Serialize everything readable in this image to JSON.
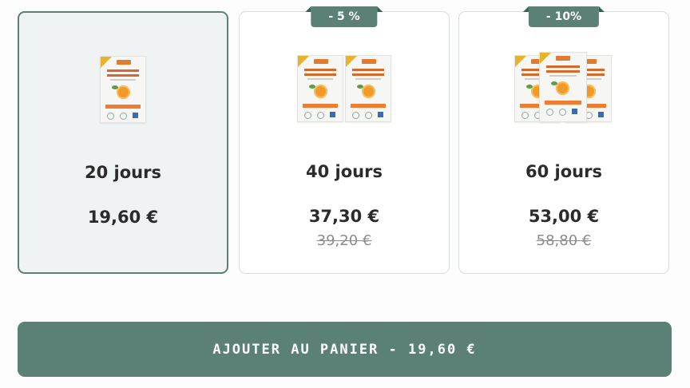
{
  "offers": [
    {
      "duration": "20 jours",
      "price": "19,60 €",
      "old_price": "",
      "badge": "",
      "selected": true,
      "boxes": 1
    },
    {
      "duration": "40 jours",
      "price": "37,30 €",
      "old_price": "39,20 €",
      "badge": "- 5 %",
      "selected": false,
      "boxes": 2
    },
    {
      "duration": "60 jours",
      "price": "53,00 €",
      "old_price": "58,80 €",
      "badge": "- 10%",
      "selected": false,
      "boxes": 3
    }
  ],
  "cta": {
    "label": "AJOUTER AU PANIER - 19,60 €"
  },
  "colors": {
    "accent": "#5b8177",
    "selected_bg": "#f0f3f3",
    "card_border": "#d8dcdc",
    "strike_text": "#8c8c8c"
  }
}
